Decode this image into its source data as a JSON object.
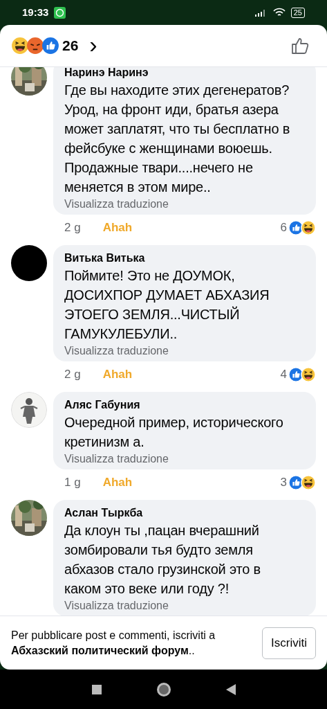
{
  "status_bar": {
    "time": "19:33",
    "battery": "25"
  },
  "header": {
    "reactions": [
      {
        "kind": "haha"
      },
      {
        "kind": "angry"
      },
      {
        "kind": "like"
      }
    ],
    "count": "26",
    "chevron": "›"
  },
  "comments": [
    {
      "avatar": {
        "kind": "picture"
      },
      "author": "Наринэ Наринэ",
      "text": "Где вы находите этих дегенератов? Урод, на фронт иди, братья азера может заплатят, что ты бесплатно в фейсбуке с женщинами воюешь. Продажные твари....нечего не меняется в этом мире..",
      "translate": "Visualizza traduzione",
      "time": "2 g",
      "reaction": "Ahah",
      "count": "6",
      "reactions": [
        {
          "kind": "like"
        },
        {
          "kind": "haha"
        }
      ]
    },
    {
      "avatar": {
        "kind": "plain"
      },
      "author": "Витька Витька",
      "text": "Поймите! Это не ДОУМОК, ДОСИХПОР ДУМАЕТ АБХАЗИЯ ЭТОЕГО ЗЕМЛЯ...ЧИСТЫЙ ГАМУКУЛЕБУЛИ..",
      "translate": "Visualizza traduzione",
      "time": "2 g",
      "reaction": "Ahah",
      "count": "4",
      "reactions": [
        {
          "kind": "like"
        },
        {
          "kind": "haha"
        }
      ]
    },
    {
      "avatar": {
        "kind": "sketch"
      },
      "author": "Аляс Габуния",
      "text": "Очередной пример, исторического кретинизм а.",
      "translate": "Visualizza traduzione",
      "time": "1 g",
      "reaction": "Ahah",
      "count": "3",
      "reactions": [
        {
          "kind": "like"
        },
        {
          "kind": "haha"
        }
      ]
    },
    {
      "avatar": {
        "kind": "picture"
      },
      "author": "Аслан Тыркба",
      "text": "Да клоун ты ,пацан вчерашний зомбировали тья будто земля абхазов стало грузинской это в каком это веке или году ?!",
      "translate": "Visualizza traduzione"
    }
  ],
  "footer": {
    "message": "Per pubblicare post e commenti, iscriviti a **Абхазский политический форум**..",
    "button": "Iscriviti"
  }
}
